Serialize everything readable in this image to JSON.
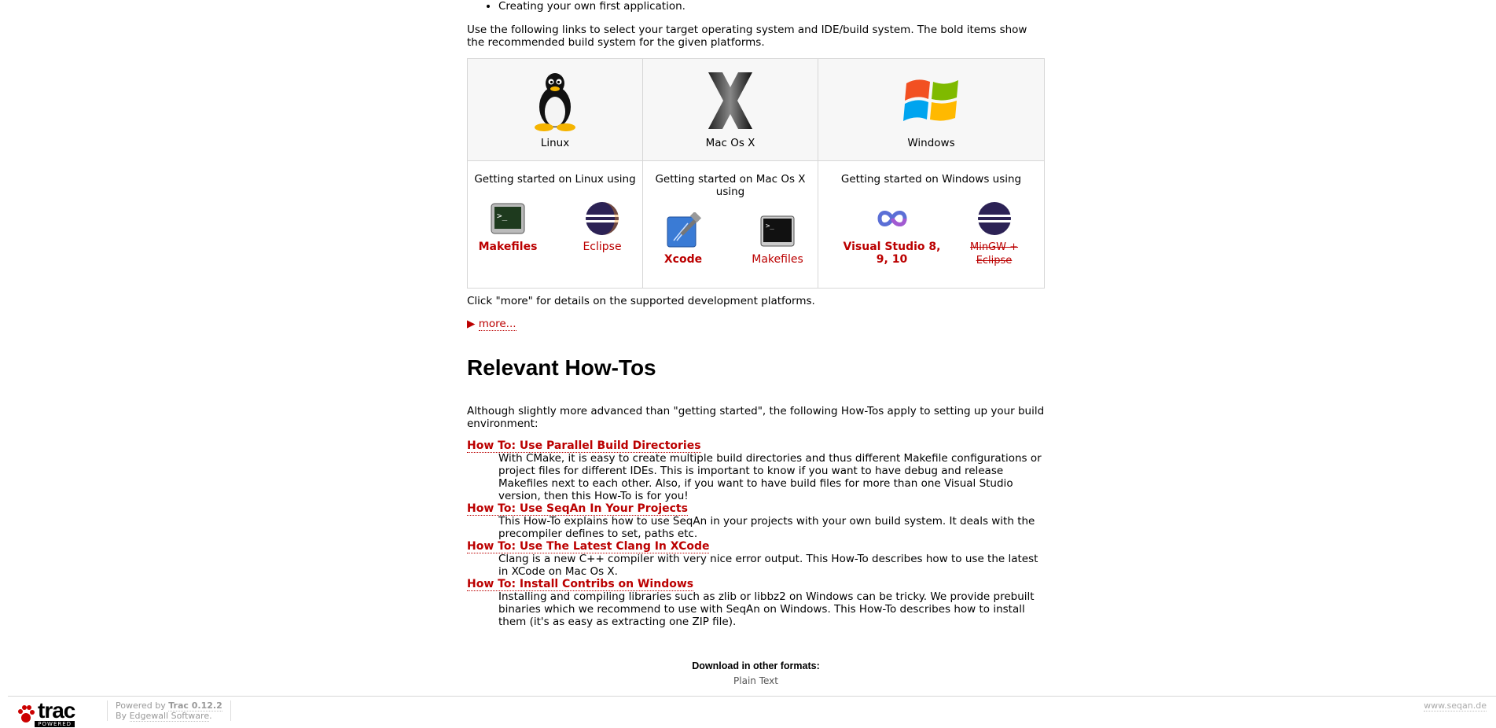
{
  "top_bullet": "Creating your own first application.",
  "intro": "Use the following links to select your target operating system and IDE/build system. The bold items show the recommended build system for the given platforms.",
  "platforms": {
    "linux": {
      "label": "Linux",
      "getting": "Getting started on Linux using",
      "tools": [
        {
          "label": "Makefiles",
          "icon": "terminal-icon"
        },
        {
          "label": "Eclipse",
          "icon": "eclipse-icon"
        }
      ]
    },
    "mac": {
      "label": "Mac Os X",
      "getting": "Getting started on Mac Os X using",
      "tools": [
        {
          "label": "Xcode",
          "icon": "xcode-icon"
        },
        {
          "label": "Makefiles",
          "icon": "terminal-icon"
        }
      ]
    },
    "windows": {
      "label": "Windows",
      "getting": "Getting started on Windows using",
      "tools": [
        {
          "label": "Visual Studio 8, 9, 10",
          "icon": "visual-studio-icon"
        },
        {
          "label": "MinGW + Eclipse",
          "icon": "eclipse-icon"
        }
      ]
    }
  },
  "click_more": "Click \"more\" for details on the supported development platforms.",
  "more_label": "more...",
  "howtos": {
    "title": "Relevant How-Tos",
    "intro": "Although slightly more advanced than \"getting started\", the following How-Tos apply to setting up your build environment:",
    "items": [
      {
        "title": "How To: Use Parallel Build Directories",
        "desc": "With CMake, it is easy to create multiple build directories and thus different Makefile configurations or project files for different IDEs. This is important to know if you want to have debug and release Makefiles next to each other. Also, if you want to have build files for more than one Visual Studio version, then this How-To is for you!"
      },
      {
        "title": "How To: Use SeqAn In Your Projects",
        "desc": "This How-To explains how to use SeqAn in your projects with your own build system. It deals with the precompiler defines to set, paths etc."
      },
      {
        "title": "How To: Use The Latest Clang In XCode",
        "desc": "Clang is a new C++ compiler with very nice error output. This How-To describes how to use the latest in XCode on Mac Os X."
      },
      {
        "title": "How To: Install Contribs on Windows",
        "desc": "Installing and compiling libraries such as zlib or libbz2 on Windows can be tricky. We provide prebuilt binaries which we recommend to use with SeqAn on Windows. This How-To describes how to install them (it's as easy as extracting one ZIP file)."
      }
    ]
  },
  "download": {
    "head": "Download in other formats:",
    "plain": "Plain Text"
  },
  "footer": {
    "logo_word": "trac",
    "logo_powered": "POWERED",
    "powered_by": "Powered by",
    "trac_version": "Trac 0.12.2",
    "by": "By",
    "edgewall": "Edgewall Software",
    "site": "www.seqan.de"
  },
  "colors": {
    "link": "#bb0000",
    "border": "#d7d7d7",
    "cell_bg": "#f7f7f7"
  }
}
